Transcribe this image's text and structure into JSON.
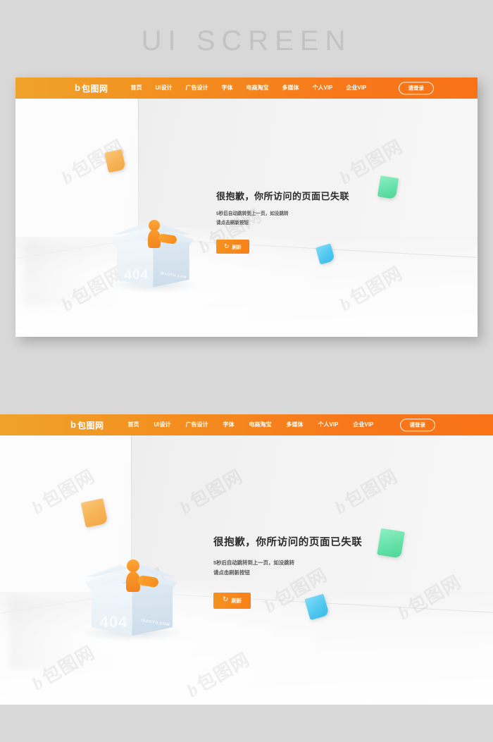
{
  "poster": {
    "title": "UI SCREEN",
    "background_color": "#d8d8d8"
  },
  "brand": {
    "logo_mark": "b",
    "logo_text": "包图网",
    "watermark_text": "包图网",
    "box_watermark": "IBAOTU.COM",
    "accent_color": "#f7801a",
    "nav_gradient_from": "#efa32b",
    "nav_gradient_to": "#f97216"
  },
  "navbar": {
    "items": [
      {
        "label": "首页"
      },
      {
        "label": "UI设计"
      },
      {
        "label": "广告设计"
      },
      {
        "label": "字体"
      },
      {
        "label": "电商淘宝"
      },
      {
        "label": "多媒体"
      },
      {
        "label": "个人VIP"
      },
      {
        "label": "企业VIP"
      }
    ],
    "login_label": "请登录"
  },
  "error_page": {
    "headline": "很抱歉，你所访问的页面已失联",
    "subline_1": "5秒后自动跳转到上一页，如没跳转",
    "subline_2": "请点击刷新按钮",
    "refresh_label": "刷新",
    "refresh_icon": "refresh-icon",
    "error_code": "404"
  },
  "illustration": {
    "box_label": "404",
    "box_mark": "IBAOTU.COM",
    "notes": [
      {
        "name": "sticky-note-orange",
        "color": "#f2a844"
      },
      {
        "name": "sticky-note-green",
        "color": "#4fd697"
      },
      {
        "name": "sticky-note-blue",
        "color": "#39bde9"
      }
    ]
  }
}
